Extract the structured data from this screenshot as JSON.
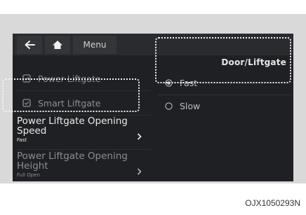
{
  "topbar": {
    "back_icon": "back-arrow-icon",
    "home_icon": "home-icon",
    "menu_label": "Menu"
  },
  "header": {
    "title": "Door/Liftgate"
  },
  "left_menu": {
    "items": [
      {
        "label": "Power Liftgate",
        "icon": "checkbox-icon"
      },
      {
        "label": "Smart Liftgate",
        "icon": "checkbox-icon"
      }
    ],
    "speed_item": {
      "line1": "Power Liftgate Opening",
      "line2": "Speed",
      "value": "Fast"
    },
    "height_item": {
      "line1": "Power Liftgate Opening",
      "line2": "Height",
      "value": "Full Open"
    }
  },
  "options": [
    {
      "label": "Fast",
      "selected": true
    },
    {
      "label": "Slow",
      "selected": false
    }
  ],
  "caption": "OJX1050293N",
  "colors": {
    "screen_bg": "#1f2023",
    "frame_bg": "#d9d9d9",
    "highlight_text": "#ececec",
    "dim_text": "#8d8e92"
  }
}
